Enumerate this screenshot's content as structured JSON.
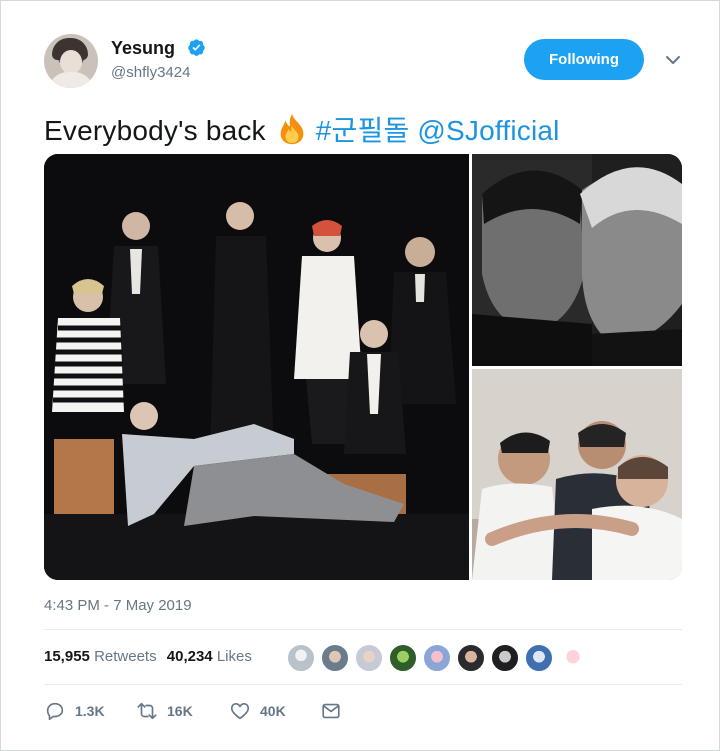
{
  "author": {
    "name": "Yesung",
    "handle": "@shfly3424",
    "verified": true
  },
  "follow_button": {
    "label": "Following"
  },
  "tweet": {
    "text_prefix": "Everybody's back",
    "emoji": "fire-emoji",
    "hashtag": "#군필돌",
    "mention": "@SJofficial"
  },
  "media": {
    "count": 3,
    "items": [
      "group-photo",
      "duo-portrait-photo",
      "group-hug-photo"
    ]
  },
  "timestamp": "4:43 PM - 7 May 2019",
  "stats": {
    "retweets_count": "15,955",
    "retweets_label": "Retweets",
    "likes_count": "40,234",
    "likes_label": "Likes"
  },
  "likers": {
    "count_shown": 10
  },
  "actions": {
    "reply_count": "1.3K",
    "retweet_count": "16K",
    "like_count": "40K"
  },
  "colors": {
    "accent": "#1da1f2",
    "link": "#1b95e0",
    "secondary_text": "#657786",
    "primary_text": "#14171a"
  }
}
